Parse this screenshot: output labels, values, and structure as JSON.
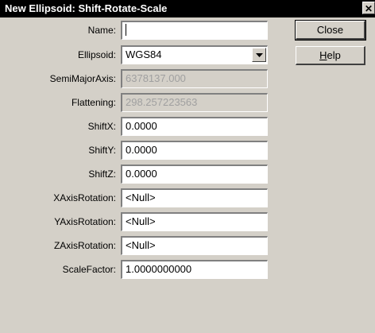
{
  "window": {
    "title": "New Ellipsoid: Shift-Rotate-Scale",
    "close_glyph": "✕"
  },
  "fields": {
    "name": {
      "label": "Name:",
      "value": ""
    },
    "ellipsoid": {
      "label": "Ellipsoid:",
      "value": "WGS84"
    },
    "semimajor": {
      "label": "SemiMajorAxis:",
      "value": "6378137.000"
    },
    "flattening": {
      "label": "Flattening:",
      "value": "298.257223563"
    },
    "shiftx": {
      "label": "ShiftX:",
      "value": "0.0000"
    },
    "shifty": {
      "label": "ShiftY:",
      "value": "0.0000"
    },
    "shiftz": {
      "label": "ShiftZ:",
      "value": "0.0000"
    },
    "xrot": {
      "label": "XAxisRotation:",
      "value": "<Null>"
    },
    "yrot": {
      "label": "YAxisRotation:",
      "value": "<Null>"
    },
    "zrot": {
      "label": "ZAxisRotation:",
      "value": "<Null>"
    },
    "scale": {
      "label": "ScaleFactor:",
      "value": "1.0000000000"
    }
  },
  "buttons": {
    "close": "Close",
    "help_mnemonic": "H",
    "help_rest": "elp"
  },
  "icons": {
    "dropdown": "chevron-down-icon",
    "close": "close-icon"
  }
}
